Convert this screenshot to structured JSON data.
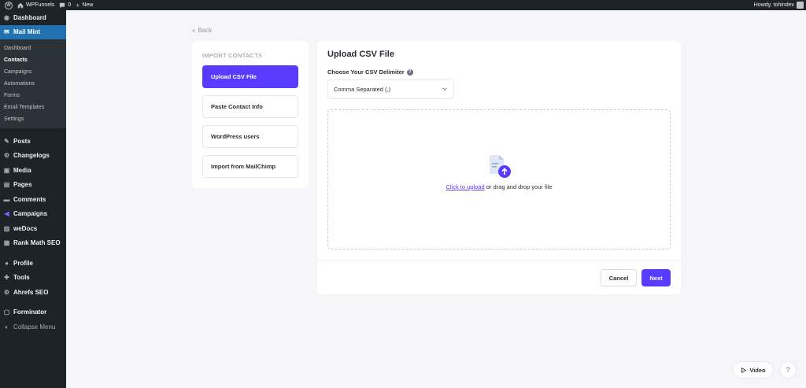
{
  "adminbar": {
    "site_name": "WPFunnels",
    "comments_count": "0",
    "new_label": "New",
    "howdy": "Howdy, tohindev"
  },
  "sidebar": {
    "dashboard": "Dashboard",
    "mailmint": "Mail Mint",
    "submenu": [
      "Dashboard",
      "Contacts",
      "Campaigns",
      "Automations",
      "Forms",
      "Email Templates",
      "Settings"
    ],
    "menu": {
      "posts": "Posts",
      "changelogs": "Changelogs",
      "media": "Media",
      "pages": "Pages",
      "comments": "Comments",
      "campaigns": "Campaigns",
      "wedocs": "weDocs",
      "rankmath": "Rank Math SEO",
      "profile": "Profile",
      "tools": "Tools",
      "ahrefs": "Ahrefs SEO",
      "forminator": "Forminator",
      "collapse": "Collapse Menu"
    }
  },
  "back_label": "Back",
  "import": {
    "title": "IMPORT CONTACTS",
    "options": [
      "Upload CSV File",
      "Paste Contact Info",
      "WordPress users",
      "Import from MailChimp"
    ]
  },
  "upload": {
    "title": "Upload CSV File",
    "delimiter_label": "Choose Your CSV Delimiter",
    "delimiter_value": "Comma Separated (,)",
    "click_link": "Click to upload",
    "drop_text": " or drag and drop your file",
    "cancel_label": "Cancel",
    "next_label": "Next"
  },
  "floating": {
    "video_label": "Video",
    "help_label": "?"
  },
  "colors": {
    "accent": "#573bff",
    "sidebar_bg": "#1d2327",
    "active_menu": "#2271b1"
  }
}
